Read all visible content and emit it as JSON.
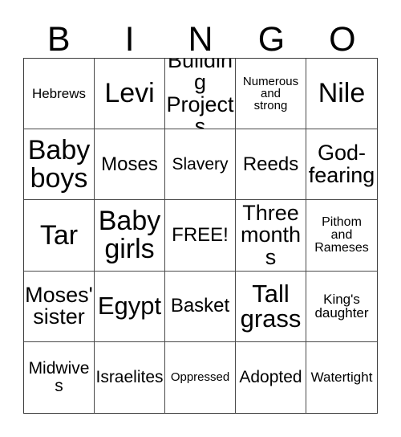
{
  "card": {
    "title_letters": [
      "B",
      "I",
      "N",
      "G",
      "O"
    ],
    "free_space_label": "FREE!",
    "colors": {
      "background": "#ffffff",
      "text": "#000000",
      "grid_line": "#4a4a4a",
      "grid_outer": "#3a3a3a"
    },
    "grid": {
      "columns": 5,
      "rows": 5,
      "cells": [
        [
          {
            "text": "Hebrews",
            "size": "sm"
          },
          {
            "text": "Levi",
            "size": "3xl"
          },
          {
            "text": "Building\nProjects",
            "size": "xl"
          },
          {
            "text": "Numerous\nand\nstrong",
            "size": "xxs"
          },
          {
            "text": "Nile",
            "size": "3xl"
          }
        ],
        [
          {
            "text": "Baby\nboys",
            "size": "3xl"
          },
          {
            "text": "Moses",
            "size": "lg"
          },
          {
            "text": "Slavery",
            "size": "md"
          },
          {
            "text": "Reeds",
            "size": "lg"
          },
          {
            "text": "God-\nfearing",
            "size": "xl"
          }
        ],
        [
          {
            "text": "Tar",
            "size": "3xl"
          },
          {
            "text": "Baby\ngirls",
            "size": "3xl"
          },
          {
            "text": "FREE!",
            "size": "lg"
          },
          {
            "text": "Three\nmonths",
            "size": "xl"
          },
          {
            "text": "Pithom\nand\nRameses",
            "size": "xs"
          }
        ],
        [
          {
            "text": "Moses'\nsister",
            "size": "xl"
          },
          {
            "text": "Egypt",
            "size": "2xl"
          },
          {
            "text": "Basket",
            "size": "lg"
          },
          {
            "text": "Tall\ngrass",
            "size": "2xl"
          },
          {
            "text": "King's\ndaughter",
            "size": "sm"
          }
        ],
        [
          {
            "text": "Midwives",
            "size": "md"
          },
          {
            "text": "Israelites",
            "size": "md"
          },
          {
            "text": "Oppressed",
            "size": "xxs"
          },
          {
            "text": "Adopted",
            "size": "md"
          },
          {
            "text": "Watertight",
            "size": "sm"
          }
        ]
      ]
    }
  }
}
